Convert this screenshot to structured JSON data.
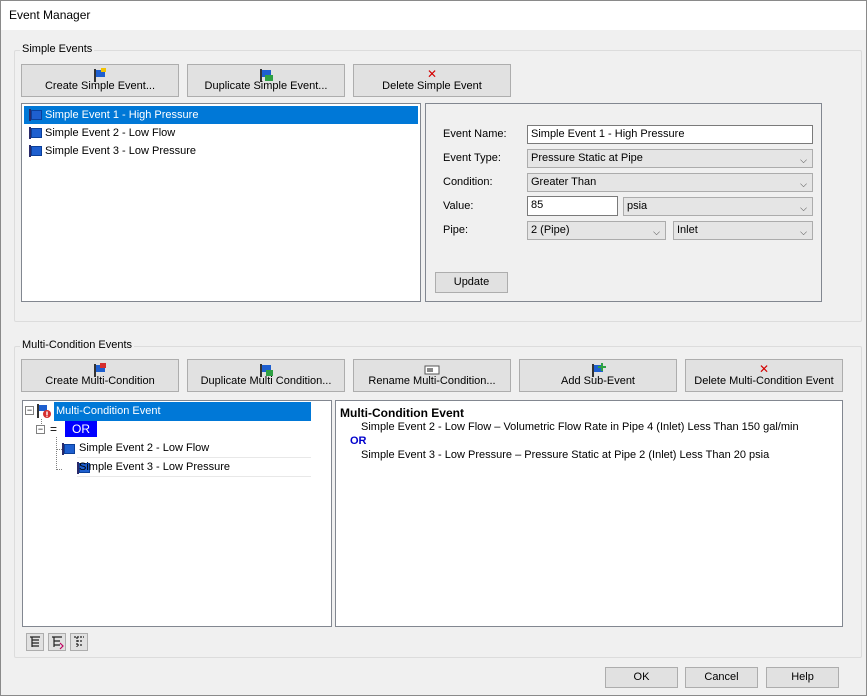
{
  "window": {
    "title": "Event Manager"
  },
  "simple_events": {
    "group_label": "Simple Events",
    "buttons": {
      "create": "Create Simple Event...",
      "duplicate": "Duplicate Simple Event...",
      "delete": "Delete Simple Event"
    },
    "list": [
      {
        "label": "Simple Event 1 - High Pressure",
        "selected": true
      },
      {
        "label": "Simple Event 2 - Low Flow",
        "selected": false
      },
      {
        "label": "Simple Event 3 - Low Pressure",
        "selected": false
      }
    ],
    "form": {
      "event_name_label": "Event Name:",
      "event_name_value": "Simple Event 1 - High Pressure",
      "event_type_label": "Event Type:",
      "event_type_value": "Pressure Static at Pipe",
      "condition_label": "Condition:",
      "condition_value": "Greater Than",
      "value_label": "Value:",
      "value_value": "85",
      "value_unit": "psia",
      "pipe_label": "Pipe:",
      "pipe_value": "2 (Pipe)",
      "pipe_location": "Inlet",
      "update_button": "Update"
    }
  },
  "multi_events": {
    "group_label": "Multi-Condition Events",
    "buttons": {
      "create": "Create Multi-Condition",
      "duplicate": "Duplicate Multi Condition...",
      "rename": "Rename Multi-Condition...",
      "add_sub": "Add Sub-Event",
      "delete": "Delete Multi-Condition Event"
    },
    "tree": {
      "root": "Multi-Condition Event",
      "operator_symbol": "=",
      "operator": "OR",
      "children": [
        "Simple Event 2 - Low Flow",
        "Simple Event 3 - Low Pressure"
      ]
    },
    "description": {
      "title": "Multi-Condition Event",
      "line1": "Simple Event 2 - Low Flow – Volumetric Flow Rate in Pipe 4 (Inlet) Less Than 150 gal/min",
      "operator": "OR",
      "line2": "Simple Event 3 - Low Pressure – Pressure Static at Pipe 2 (Inlet) Less Than 20 psia"
    }
  },
  "footer": {
    "ok": "OK",
    "cancel": "Cancel",
    "help": "Help"
  },
  "icons": {
    "create_simple": "flag-add-icon",
    "duplicate_simple": "flag-duplicate-icon",
    "delete": "red-x-icon",
    "multi": "multi-flag-icon",
    "rename": "rename-icon",
    "add_sub": "flag-plus-icon"
  },
  "colors": {
    "selection": "#0078d7",
    "or_highlight": "#0000cc",
    "delete_x": "#d40000"
  }
}
